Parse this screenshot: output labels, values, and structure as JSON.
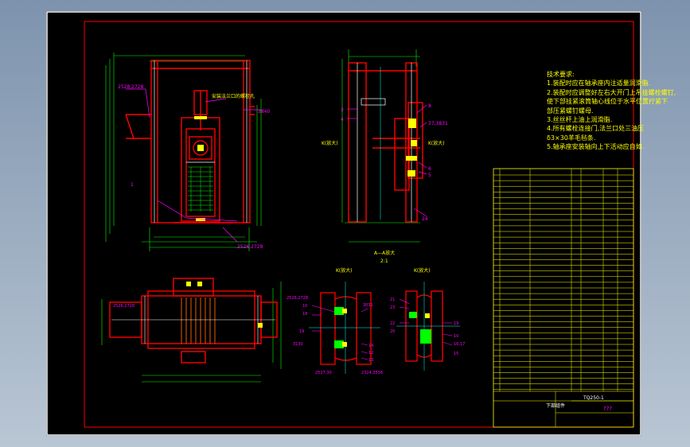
{
  "notes": {
    "title": "技术要求:",
    "items": [
      "1.装配时应在轴承座内注适量润滑脂.",
      "2.装配时应调整好左右大开门上吊挂螺栓螺钉,",
      "使下部挂紧滚筒轴心线位于水平位置拧紧下",
      "部压紧螺钉螺母.",
      "3.丝丝杆上油上润滑脂.",
      "4.所有螺栓连接门,法兰口处三油压",
      "δ3×30羊毛毡条.",
      "5.轴承座安装轴向上下活动应自如."
    ]
  },
  "labels": {
    "front_a": "2528,2728",
    "front_b": "1",
    "front_c": "2526,2728",
    "front_d": "安装法兰口的螺栓孔",
    "front_e": "3840",
    "side_1": "3",
    "side_2": "4",
    "side_3": "8",
    "side_4": "37,3831",
    "side_5": "6",
    "side_6": "5",
    "side_7": "24",
    "side_k": "K(放大)",
    "side_k2": "K(放大)",
    "section_title": "A—A放大",
    "section_scale": "2:1",
    "det_left_title": "K(放大)",
    "det_right_title": "K(放大)",
    "dl_1": "2526,2728",
    "dl_2": "10",
    "dl_3": "18",
    "dl_4": "3031",
    "dl_5": "19",
    "dl_6": "3130",
    "dl_7": "14",
    "dl_8": "12",
    "dl_9": "13",
    "dl_10": "2527,30",
    "dl_11": "2324,3536",
    "dr_1": "21",
    "dr_2": "23",
    "dr_3": "22",
    "dr_4": "20",
    "dr_5": "19",
    "dr_6": "10",
    "dr_7": "16,17",
    "dr_8": "15",
    "plan_a": "2526,2728"
  },
  "title_block": {
    "drawing_no": "TQ250-1",
    "name": "下部组件",
    "ref": "???"
  },
  "colors": {
    "background": "#7d93ad",
    "sheet": "#000000",
    "border": "#ffffff",
    "frame": "#ff0000",
    "dimension": "#00ff00",
    "note": "#ffff00",
    "leader": "#ff00ff",
    "center": "#00ffff"
  }
}
